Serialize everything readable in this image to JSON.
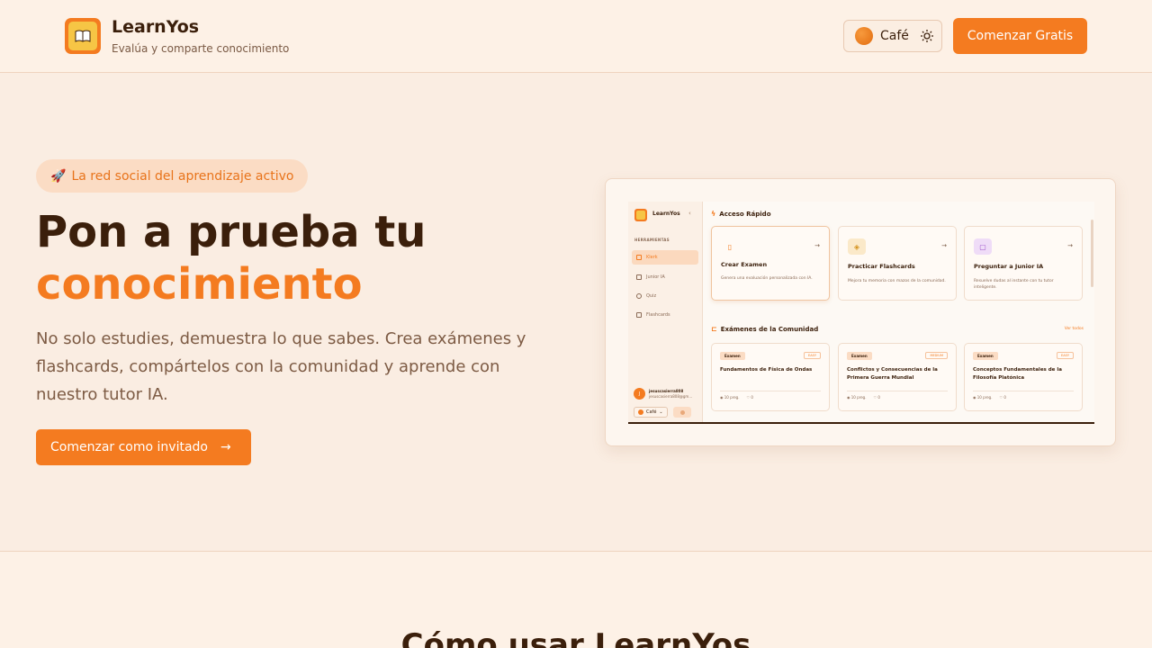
{
  "header": {
    "brand": "LearnYos",
    "tagline": "Evalúa y comparte conocimiento",
    "theme_label": "Café",
    "cta_label": "Comenzar Gratis"
  },
  "hero": {
    "pill_icon": "🚀",
    "pill_text": "La red social del aprendizaje activo",
    "title_line1": "Pon a prueba tu",
    "title_line2": "conocimiento",
    "description": "No solo estudies, demuestra lo que sabes. Crea exámenes y flashcards, compártelos con la comunidad y aprende con nuestro tutor IA.",
    "cta_label": "Comenzar como invitado",
    "cta_arrow": "→"
  },
  "preview": {
    "brand": "LearnYos",
    "section_label": "HERRAMIENTAS",
    "nav": [
      {
        "label": "Klerk"
      },
      {
        "label": "Junior IA"
      },
      {
        "label": "Quiz"
      },
      {
        "label": "Flashcards"
      }
    ],
    "user": {
      "initial": "J",
      "name": "jesuscasierra808",
      "email": "jesuscasierra808@gm..."
    },
    "theme_label": "Café",
    "quick_access_title": "Acceso Rápido",
    "quick_access": [
      {
        "title": "Crear Examen",
        "desc": "Genera una evaluación personalizada con IA."
      },
      {
        "title": "Practicar Flashcards",
        "desc": "Mejora tu memoria con mazos de la comunidad."
      },
      {
        "title": "Preguntar a Junior IA",
        "desc": "Resuelve dudas al instante con tu tutor inteligente."
      }
    ],
    "community_title": "Exámenes de la Comunidad",
    "see_all": "Ver todos",
    "exams": [
      {
        "tag": "Examen",
        "level": "EASY",
        "title": "Fundamentos de Física de Ondas",
        "questions": "10 preg.",
        "likes": "0"
      },
      {
        "tag": "Examen",
        "level": "MEDIUM",
        "title": "Conflictos y Consecuencias de la Primera Guerra Mundial",
        "questions": "10 preg.",
        "likes": "0"
      },
      {
        "tag": "Examen",
        "level": "EASY",
        "title": "Conceptos Fundamentales de la Filosofía Platónica",
        "questions": "10 preg.",
        "likes": "0"
      }
    ]
  },
  "section2": {
    "title": "Cómo usar LearnYos"
  },
  "colors": {
    "accent": "#f47b20",
    "background": "#faede2",
    "text": "#3b1f0b"
  }
}
